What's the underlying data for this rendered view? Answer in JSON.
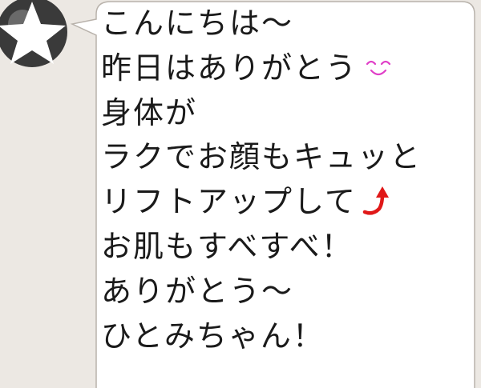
{
  "chat": {
    "incoming_message": {
      "lines": [
        "こんにちは〜",
        "昨日はありがとう",
        "身体が",
        "ラクでお顔もキュッと",
        "リフトアップして",
        "お肌もすべすべ！",
        "ありがとう〜",
        "ひとみちゃん！"
      ],
      "smile_emoji_icon": "smile-emoji",
      "up_arrow_icon": "up-arrow-emoji"
    }
  },
  "colors": {
    "background": "#ece8e3",
    "bubble_fill": "#ffffff",
    "bubble_border": "#b8b2ab",
    "smile_emoji": "#e040c8",
    "up_arrow": "#e01818"
  }
}
